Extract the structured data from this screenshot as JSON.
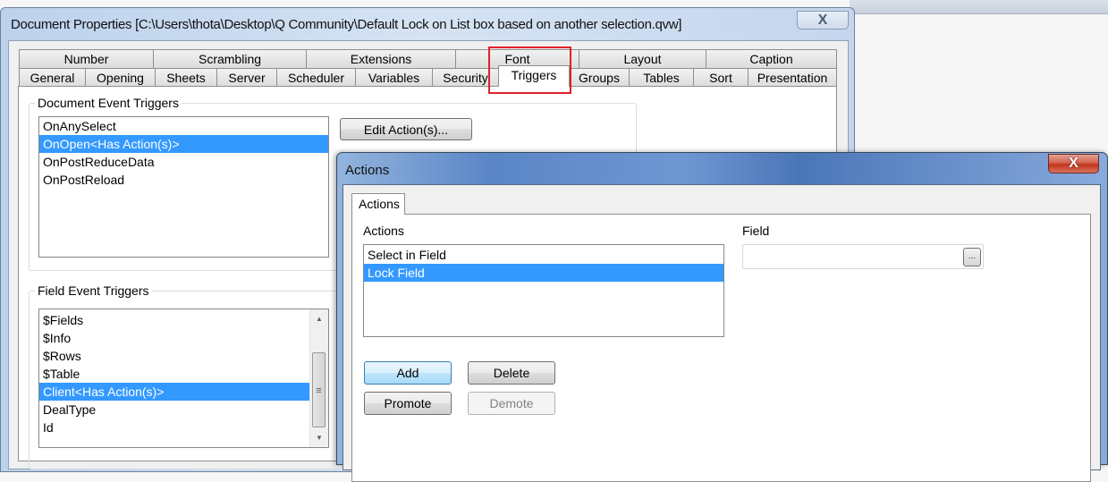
{
  "main_dialog": {
    "title": "Document Properties [C:\\Users\\thota\\Desktop\\Q Community\\Default Lock on List box based on another selection.qvw]",
    "close_glyph": "X",
    "tabs_row1": [
      "Number",
      "Scrambling",
      "Extensions",
      "Font",
      "Layout",
      "Caption"
    ],
    "tabs_row2": [
      "General",
      "Opening",
      "Sheets",
      "Server",
      "Scheduler",
      "Variables",
      "Security",
      "Triggers",
      "Groups",
      "Tables",
      "Sort",
      "Presentation"
    ],
    "active_tab": "Triggers",
    "highlight_color": "#e0202a",
    "document_event_triggers": {
      "label": "Document Event Triggers",
      "items": [
        "OnAnySelect",
        "OnOpen<Has Action(s)>",
        "OnPostReduceData",
        "OnPostReload"
      ],
      "selected_index": 1,
      "edit_button": "Edit Action(s)..."
    },
    "field_event_triggers": {
      "label": "Field Event Triggers",
      "items": [
        "$Fields",
        "$Info",
        "$Rows",
        "$Table",
        "Client<Has Action(s)>",
        "DealType",
        "Id"
      ],
      "selected_index": 4
    }
  },
  "actions_dialog": {
    "title": "Actions",
    "close_glyph": "X",
    "tab_label": "Actions",
    "actions_label": "Actions",
    "actions": [
      "Select in Field",
      "Lock Field"
    ],
    "selected_index": 1,
    "field_label": "Field",
    "field_value": "",
    "browse_label": "...",
    "buttons": {
      "add": "Add",
      "delete": "Delete",
      "promote": "Promote",
      "demote": "Demote"
    },
    "selection_color": "#3399ff"
  }
}
